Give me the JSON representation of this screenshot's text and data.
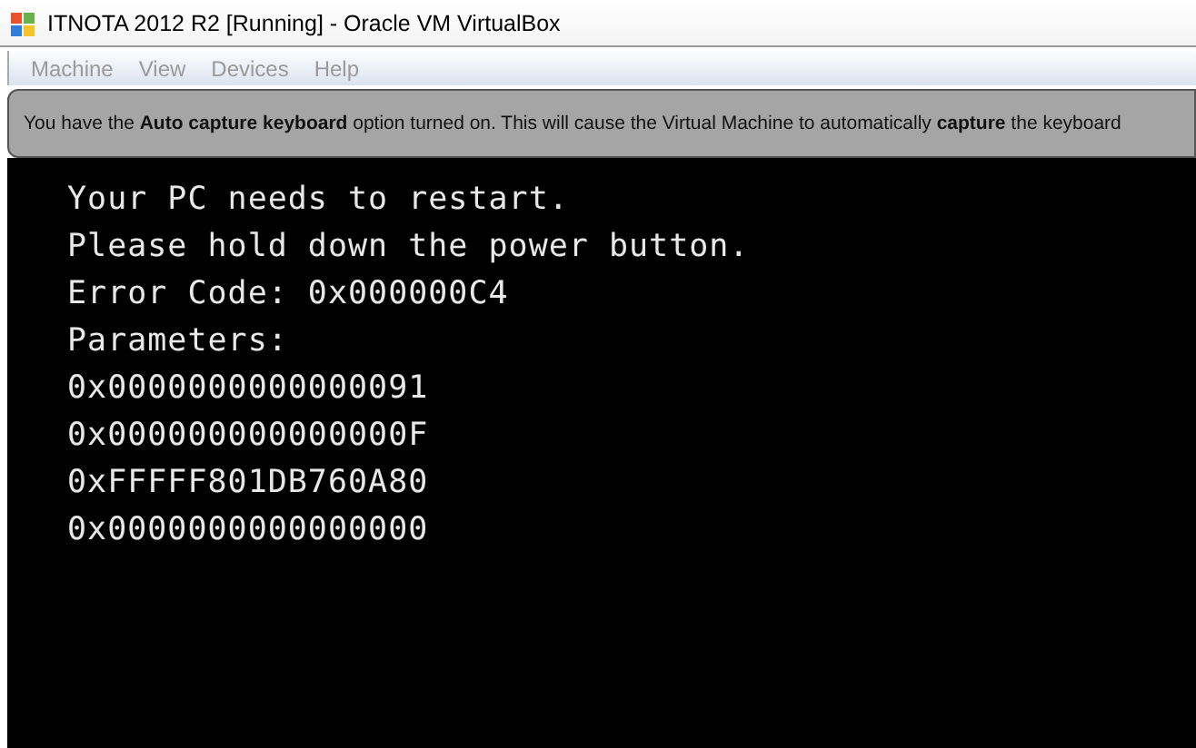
{
  "window": {
    "title": "ITNOTA 2012 R2 [Running] - Oracle VM VirtualBox"
  },
  "menu": [
    {
      "label": "Machine",
      "disabled": true
    },
    {
      "label": "View",
      "disabled": true
    },
    {
      "label": "Devices",
      "disabled": true
    },
    {
      "label": "Help",
      "disabled": true
    }
  ],
  "notice": {
    "text": "You have the **Auto capture keyboard** option turned on. This will cause the Virtual Machine to automatically **capture** the keyboard"
  },
  "screen": {
    "lines": [
      "Your PC needs to restart.",
      "Please hold down the power button.",
      "Error Code: 0x000000C4",
      "Parameters:",
      "0x0000000000000091",
      "0x000000000000000F",
      "0xFFFFF801DB760A80",
      "0x0000000000000000"
    ]
  }
}
